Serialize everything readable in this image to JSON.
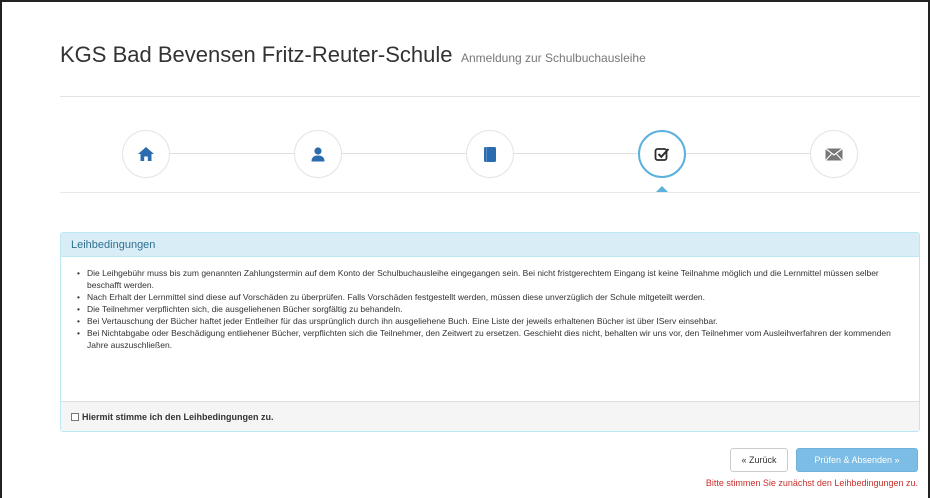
{
  "header": {
    "school_name": "KGS Bad Bevensen Fritz-Reuter-Schule",
    "subtitle": "Anmeldung zur Schulbuchausleihe"
  },
  "wizard": {
    "steps": [
      {
        "icon": "home-icon",
        "active": false
      },
      {
        "icon": "user-icon",
        "active": false
      },
      {
        "icon": "book-icon",
        "active": false
      },
      {
        "icon": "check-square-icon",
        "active": true
      },
      {
        "icon": "envelope-icon",
        "active": false
      }
    ],
    "accent_color": "#2b6cae",
    "active_border_color": "#5cb0de"
  },
  "panel": {
    "heading": "Leihbedingungen",
    "items": [
      "Die Leihgebühr muss bis zum genannten Zahlungstermin auf dem Konto der Schulbuchausleihe eingegangen sein. Bei nicht fristgerechtem Eingang ist keine Teilnahme möglich und die Lernmittel müssen selber beschafft werden.",
      "Nach Erhalt der Lernmittel sind diese auf Vorschäden zu überprüfen. Falls Vorschäden festgestellt werden, müssen diese unverzüglich der Schule mitgeteilt werden.",
      "Die Teilnehmer verpflichten sich, die ausgeliehenen Bücher sorgfältig zu behandeln.",
      "Bei Vertauschung der Bücher haftet jeder Entleiher für das ursprünglich durch ihn ausgeliehene Buch. Eine Liste der jeweils erhaltenen Bücher ist über IServ einsehbar.",
      "Bei Nichtabgabe oder Beschädigung entliehener Bücher, verpflichten sich die Teilnehmer, den Zeitwert zu ersetzen. Geschieht dies nicht, behalten wir uns vor, den Teilnehmer vom Ausleihverfahren der kommenden Jahre auszuschließen."
    ],
    "agree_label": "Hiermit stimme ich den Leihbedingungen zu.",
    "agree_checked": false
  },
  "actions": {
    "back_label": "« Zurück",
    "submit_label": "Prüfen & Absenden »",
    "error_text": "Bitte stimmen Sie zunächst den Leihbedingungen zu."
  }
}
